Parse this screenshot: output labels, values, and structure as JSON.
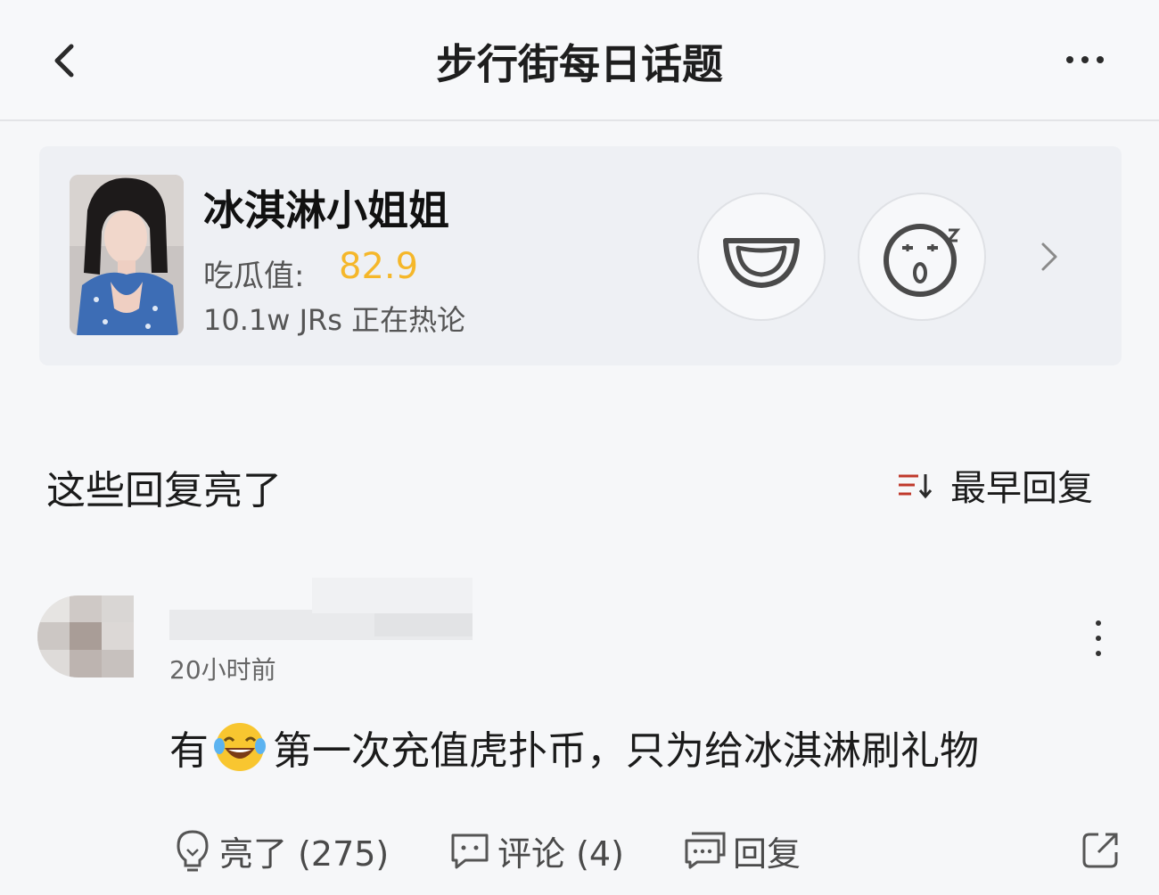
{
  "header": {
    "title": "步行街每日话题",
    "back_icon": "chevron-left-icon",
    "more_icon": "more-horizontal-icon"
  },
  "topic": {
    "name": "冰淇淋小姐姐",
    "gua_label": "吃瓜值:",
    "gua_value": "82.9",
    "hot_text": "10.1w JRs 正在热论",
    "reactions": [
      "smile-emoji-icon",
      "surprised-emoji-icon"
    ],
    "arrow_icon": "chevron-right-icon",
    "accent_color": "#f5b72a"
  },
  "section": {
    "title": "这些回复亮了",
    "sort_label": "最早回复",
    "sort_icon": "sort-icon"
  },
  "reply": {
    "time": "20小时前",
    "body_before": "有",
    "emoji": "laughing-tears-emoji-icon",
    "body_after": "第一次充值虎扑币，只为给冰淇淋刷礼物",
    "actions": {
      "like_label": "亮了 (275)",
      "comment_label": "评论 (4)",
      "reply_label": "回复"
    }
  }
}
